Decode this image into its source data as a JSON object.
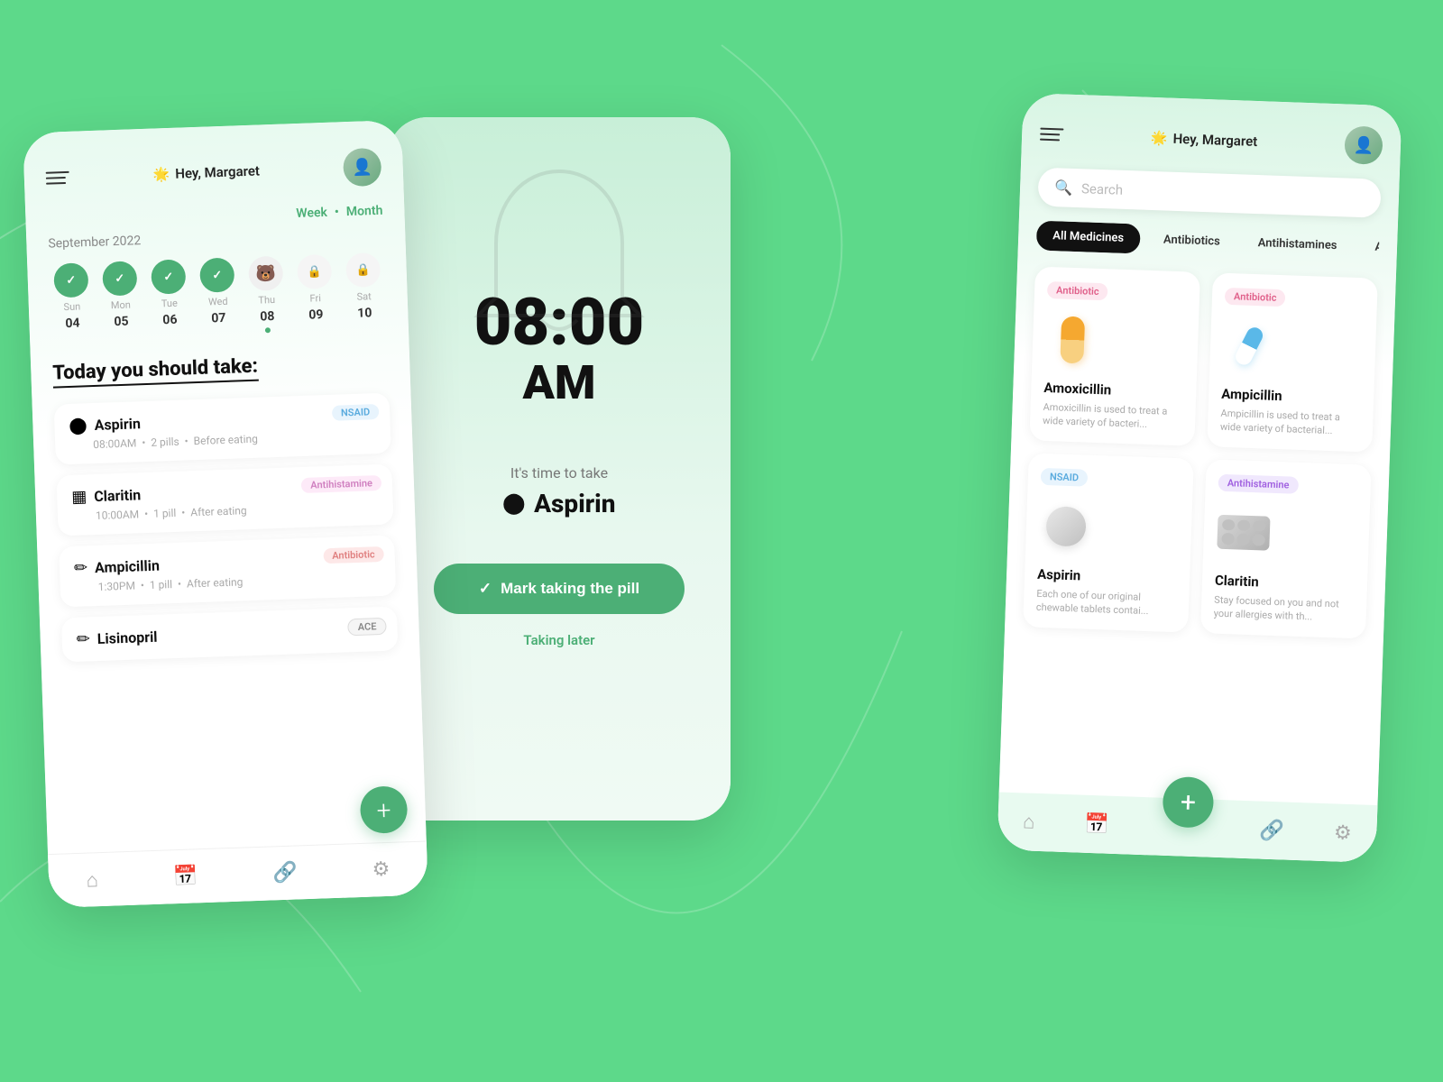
{
  "background": {
    "color": "#5dd98a"
  },
  "phone_left": {
    "greeting": "Hey, Margaret",
    "greeting_emoji": "🌟",
    "view_week": "Week",
    "view_dot": "•",
    "view_month": "Month",
    "month_label": "September 2022",
    "calendar": [
      {
        "name": "Sun",
        "num": "04",
        "type": "checked"
      },
      {
        "name": "Mon",
        "num": "05",
        "type": "checked"
      },
      {
        "name": "Tue",
        "num": "06",
        "type": "checked"
      },
      {
        "name": "Wed",
        "num": "07",
        "type": "checked"
      },
      {
        "name": "Thu",
        "num": "08",
        "type": "emoji",
        "emoji": "🐻"
      },
      {
        "name": "Fri",
        "num": "09",
        "type": "locked"
      },
      {
        "name": "Sat",
        "num": "10",
        "type": "locked"
      }
    ],
    "today_header": "Today you should take:",
    "medicines": [
      {
        "name": "Aspirin",
        "detail": "08:00AM  •  2 pills  •  Before eating",
        "badge": "NSAID",
        "badge_type": "nsaid",
        "icon": "💊"
      },
      {
        "name": "Claritin",
        "detail": "10:00AM  •  1 pill  •  After eating",
        "badge": "Antihistamine",
        "badge_type": "antihistamine",
        "icon": "💊"
      },
      {
        "name": "Ampicillin",
        "detail": "1:30PM  •  1 pill  •  After eating",
        "badge": "Antibiotic",
        "badge_type": "antibiotic",
        "icon": "💊"
      },
      {
        "name": "Lisinopril",
        "detail": "",
        "badge": "ACE",
        "badge_type": "ace",
        "icon": "💊"
      }
    ],
    "fab_label": "+",
    "nav_icons": [
      "🏠",
      "📅",
      "🔗",
      "⚙️"
    ]
  },
  "phone_middle": {
    "time": "08:00",
    "am": "AM",
    "sub_text": "It's time to take",
    "medicine_name": "Aspirin",
    "mark_btn_label": "Mark taking the pill",
    "taking_later": "Taking later"
  },
  "phone_right": {
    "greeting": "Hey, Margaret",
    "greeting_emoji": "🌟",
    "search_placeholder": "Search",
    "filter_tabs": [
      {
        "label": "All Medicines",
        "active": true
      },
      {
        "label": "Antibiotics",
        "active": false
      },
      {
        "label": "Antihistamines",
        "active": false
      },
      {
        "label": "ACE",
        "active": false
      }
    ],
    "medicines": [
      {
        "name": "Amoxicillin",
        "badge": "Antibiotic",
        "badge_type": "pink",
        "desc": "Amoxicillin is used to treat a wide variety of bacteri...",
        "img_type": "capsule-orange"
      },
      {
        "name": "Ampicillin",
        "badge": "Antibiotic",
        "badge_type": "pink",
        "desc": "Ampicillin is used to treat a wide variety of bacterial...",
        "img_type": "capsule-blue"
      },
      {
        "name": "Aspirin",
        "badge": "NSAID",
        "badge_type": "blue",
        "desc": "Each one of our original chewable tablets contai...",
        "img_type": "round-pill"
      },
      {
        "name": "Claritin",
        "badge": "Antihistamine",
        "badge_type": "purple",
        "desc": "Stay focused on you and not your allergies with th...",
        "img_type": "strip"
      }
    ],
    "fab_label": "+",
    "nav_icons": [
      "🏠",
      "📅",
      "🔗",
      "⚙️"
    ]
  }
}
